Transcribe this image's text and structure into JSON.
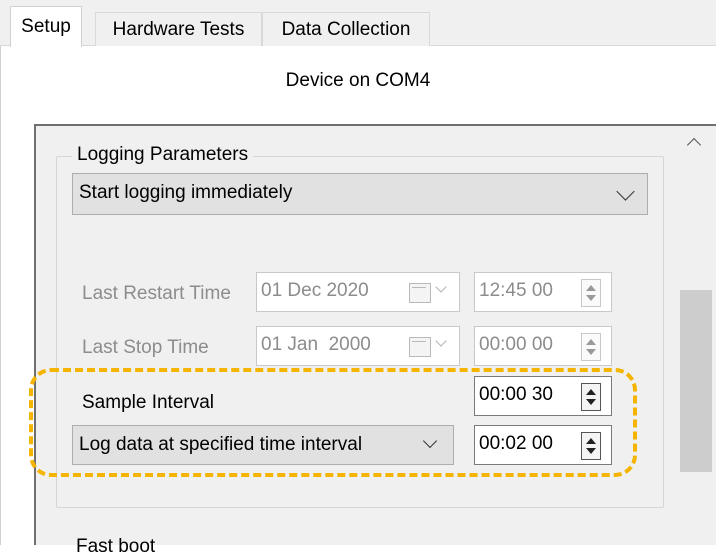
{
  "tabs": [
    {
      "label": "Setup"
    },
    {
      "label": "Hardware Tests"
    },
    {
      "label": "Data Collection"
    }
  ],
  "device_title": "Device on COM4",
  "logging_group": {
    "title": "Logging Parameters",
    "start_mode": "Start logging immediately",
    "last_restart": {
      "label": "Last Restart Time",
      "date": "01 Dec 2020",
      "time": "12:45 00"
    },
    "last_stop": {
      "label": "Last Stop Time",
      "date": "01 Jan  2000",
      "time": "00:00 00"
    },
    "sample_interval": {
      "label": "Sample Interval",
      "value": "00:00 30"
    },
    "log_mode": {
      "value": "Log data at specified time interval",
      "interval": "00:02 00"
    }
  },
  "next_section_label": "Fast boot",
  "colors": {
    "highlight": "#f5b400",
    "panel": "#f0f0f0",
    "disabled_text": "#8c8c8c"
  }
}
